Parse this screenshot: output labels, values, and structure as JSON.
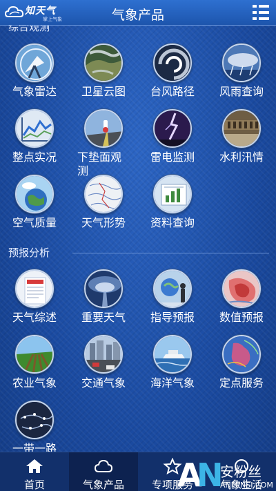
{
  "header": {
    "title": "气象产品",
    "logo_text": "知天气",
    "logo_sub": "掌上气象"
  },
  "sections": [
    {
      "title": "综合观测",
      "items": [
        {
          "label": "气象雷达",
          "icon": "radar-icon"
        },
        {
          "label": "卫星云图",
          "icon": "satellite-icon"
        },
        {
          "label": "台风路径",
          "icon": "typhoon-icon"
        },
        {
          "label": "风雨查询",
          "icon": "wind-rain-icon"
        },
        {
          "label": "整点实况",
          "icon": "hourly-chart-icon"
        },
        {
          "label": "下垫面观测",
          "icon": "surface-observation-icon"
        },
        {
          "label": "雷电监测",
          "icon": "lightning-icon"
        },
        {
          "label": "水利汛情",
          "icon": "flood-icon"
        },
        {
          "label": "空气质量",
          "icon": "air-quality-icon"
        },
        {
          "label": "天气形势",
          "icon": "weather-map-icon"
        },
        {
          "label": "资料查询",
          "icon": "data-query-icon"
        }
      ]
    },
    {
      "title": "预报分析",
      "items": [
        {
          "label": "天气综述",
          "icon": "weather-summary-icon"
        },
        {
          "label": "重要天气",
          "icon": "severe-weather-icon"
        },
        {
          "label": "指导预报",
          "icon": "guidance-forecast-icon"
        },
        {
          "label": "数值预报",
          "icon": "numerical-forecast-icon"
        },
        {
          "label": "农业气象",
          "icon": "agriculture-icon"
        },
        {
          "label": "交通气象",
          "icon": "traffic-icon"
        },
        {
          "label": "海洋气象",
          "icon": "ocean-icon"
        },
        {
          "label": "定点服务",
          "icon": "fixed-point-icon"
        },
        {
          "label": "一带一路",
          "icon": "belt-road-icon"
        }
      ]
    }
  ],
  "nav": [
    {
      "label": "首页",
      "icon": "home-icon"
    },
    {
      "label": "气象产品",
      "icon": "cloud-icon"
    },
    {
      "label": "专项服务",
      "icon": "star-icon"
    },
    {
      "label": "气象生活",
      "icon": "life-icon"
    }
  ],
  "watermark": {
    "big": "AN",
    "cn": "安粉丝",
    "url": "ANFENSI.COM"
  },
  "colors": {
    "background": "#1d4fa6",
    "header": "#2e70d0",
    "nav": "#12306b",
    "nav_active": "#0d2250"
  }
}
